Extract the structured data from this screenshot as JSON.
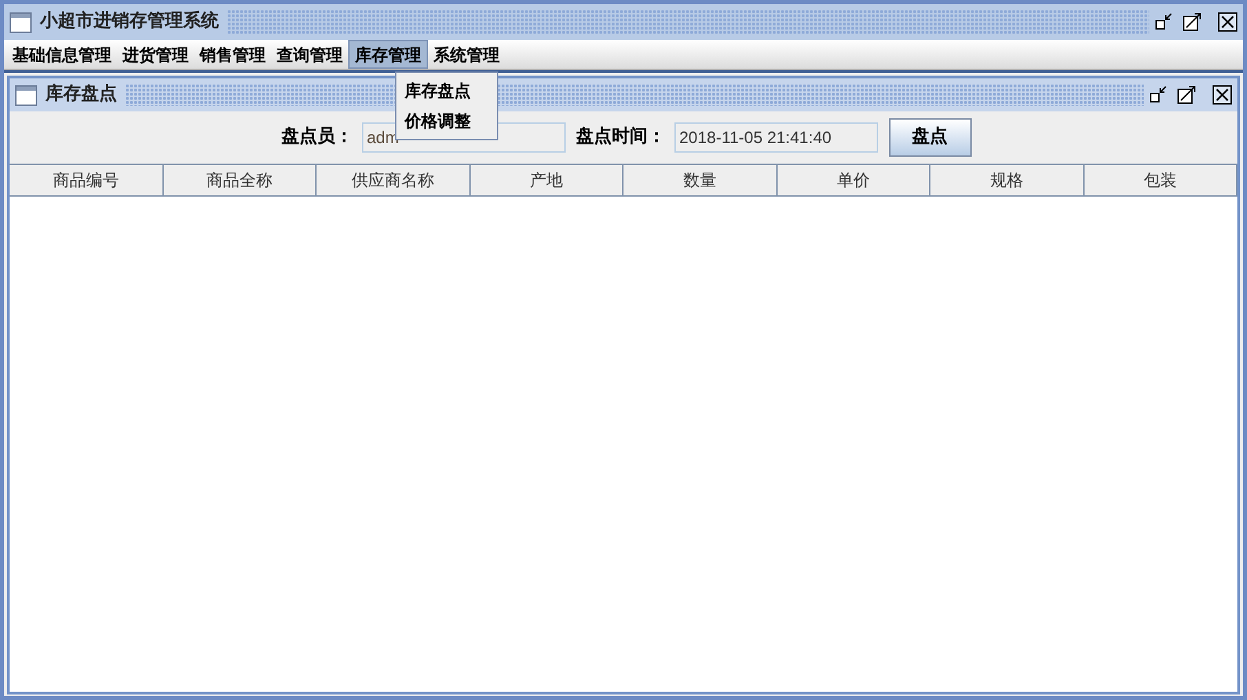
{
  "window": {
    "title": "小超市进销存管理系统"
  },
  "menu_bar": [
    {
      "label": "基础信息管理",
      "selected": false
    },
    {
      "label": "进货管理",
      "selected": false
    },
    {
      "label": "销售管理",
      "selected": false
    },
    {
      "label": "查询管理",
      "selected": false
    },
    {
      "label": "库存管理",
      "selected": true
    },
    {
      "label": "系统管理",
      "selected": false
    }
  ],
  "open_menu": {
    "items": [
      "库存盘点",
      "价格调整"
    ]
  },
  "internal_frame": {
    "title": "库存盘点",
    "form": {
      "checker_label": "盘点员：",
      "checker_value": "adm",
      "time_label": "盘点时间：",
      "time_value": "2018-11-05 21:41:40",
      "button": "盘点"
    },
    "table": {
      "columns": [
        "商品编号",
        "商品全称",
        "供应商名称",
        "产地",
        "数量",
        "单价",
        "规格",
        "包装"
      ]
    }
  }
}
